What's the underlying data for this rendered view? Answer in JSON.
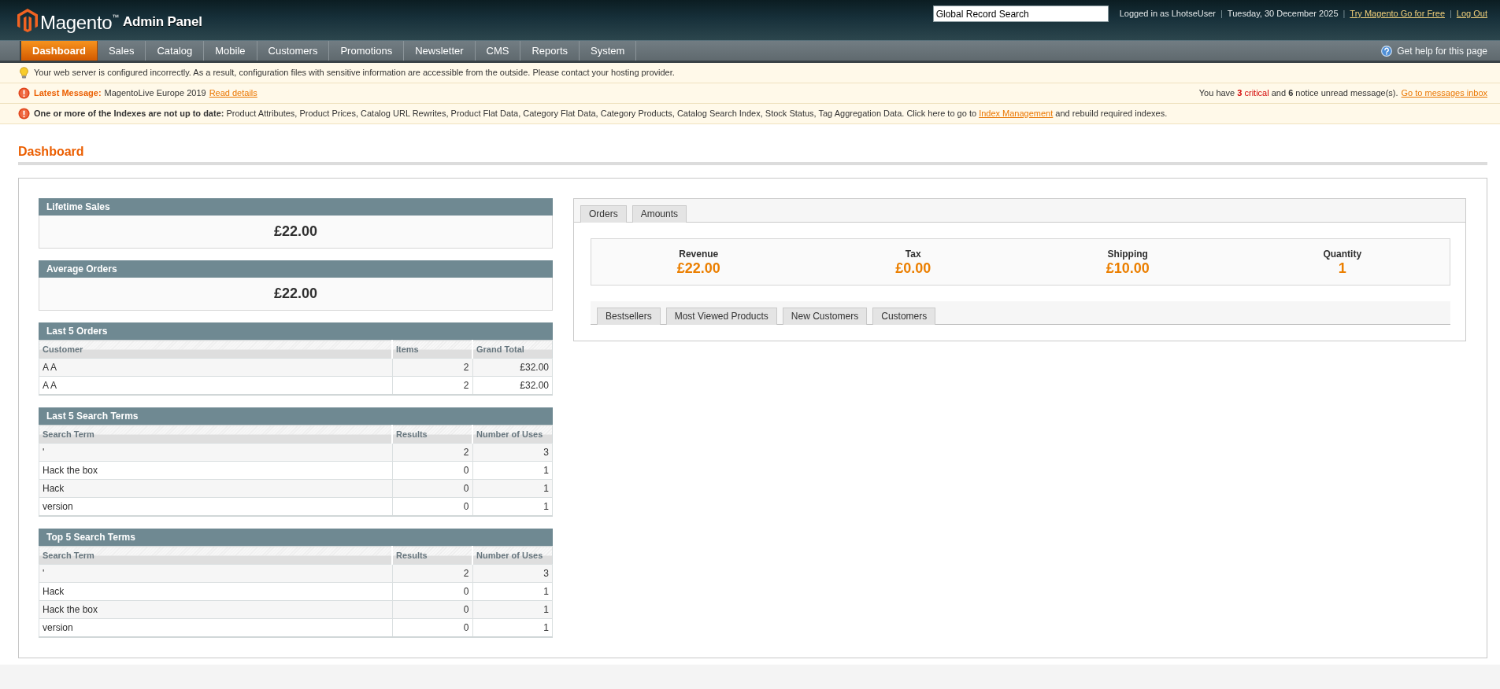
{
  "header": {
    "logo": {
      "brand": "Magento$^{™}$",
      "subtitle": "Admin Panel"
    },
    "search": {
      "value": "Global Record Search"
    },
    "user_bar": [
      {
        "kind": "text",
        "text": "Logged in as LhotseUser"
      },
      {
        "kind": "separator",
        "text": "|"
      },
      {
        "kind": "text",
        "text": "Tuesday, 30 December 2025"
      },
      {
        "kind": "separator",
        "text": "|"
      },
      {
        "kind": "link",
        "text": "Try Magento Go for Free"
      },
      {
        "kind": "separator",
        "text": "|"
      },
      {
        "kind": "link",
        "text": "Log Out"
      }
    ]
  },
  "nav": {
    "items": [
      {
        "label": "Dashboard",
        "selected": true
      },
      {
        "label": "Sales",
        "selected": false
      },
      {
        "label": "Catalog",
        "selected": false
      },
      {
        "label": "Mobile",
        "selected": false
      },
      {
        "label": "Customers",
        "selected": false
      },
      {
        "label": "Promotions",
        "selected": false
      },
      {
        "label": "Newsletter",
        "selected": false
      },
      {
        "label": "CMS",
        "selected": false
      },
      {
        "label": "Reports",
        "selected": false
      },
      {
        "label": "System",
        "selected": false
      }
    ],
    "help": "Get help for this page"
  },
  "messages": [
    {
      "kind": "notice",
      "text": "Your web server is configured incorrectly. As a result, configuration files with sensitive information are accessible from the outside. Please contact your hosting provider."
    },
    {
      "kind": "latest",
      "label": "Latest Message:",
      "text": "MagentoLive Europe 2019",
      "link": "Read details",
      "summary": {
        "lead": "You have",
        "critical_count": "3",
        "critical_label": "critical",
        "joiner": "and",
        "notice_count": "6",
        "tail": "notice unread message(s)."
      },
      "inbox_link": "Go to messages inbox"
    },
    {
      "kind": "index_warning",
      "text": "**One or more of the Indexes are not up to date:** Product Attributes, Product Prices, Catalog URL Rewrites, Product Flat Data, Category Flat Data, Category Products, Catalog Search Index, Stock Status, Tag Aggregation Data. Click here to go to",
      "link": "Index Management",
      "text_after": "and rebuild required indexes."
    }
  ],
  "page_title": "Dashboard",
  "left_panels": [
    {
      "kind": "stat",
      "title": "Lifetime Sales",
      "value": "£22.00"
    },
    {
      "kind": "stat",
      "title": "Average Orders",
      "value": "£22.00"
    },
    {
      "kind": "grid",
      "title": "Last 5 Orders",
      "columns": [
        "Customer",
        "Items",
        "Grand Total"
      ],
      "rows": [
        [
          "A A",
          "2",
          "£32.00"
        ],
        [
          "A A",
          "2",
          "£32.00"
        ]
      ]
    },
    {
      "kind": "grid",
      "title": "Last 5 Search Terms",
      "columns": [
        "Search Term",
        "Results",
        "Number of Uses"
      ],
      "rows": [
        [
          "'",
          "2",
          "3"
        ],
        [
          "Hack the box",
          "0",
          "1"
        ],
        [
          "Hack",
          "0",
          "1"
        ],
        [
          "version",
          "0",
          "1"
        ]
      ]
    },
    {
      "kind": "grid",
      "title": "Top 5 Search Terms",
      "columns": [
        "Search Term",
        "Results",
        "Number of Uses"
      ],
      "rows": [
        [
          "'",
          "2",
          "3"
        ],
        [
          "Hack",
          "0",
          "1"
        ],
        [
          "Hack the box",
          "0",
          "1"
        ],
        [
          "version",
          "0",
          "1"
        ]
      ]
    }
  ],
  "right_panel": {
    "tabs": [
      {
        "label": "Orders",
        "selected": false
      },
      {
        "label": "Amounts",
        "selected": false
      }
    ],
    "totals": [
      {
        "label": "Revenue",
        "value": "£22.00"
      },
      {
        "label": "Tax",
        "value": "£0.00"
      },
      {
        "label": "Shipping",
        "value": "£10.00"
      },
      {
        "label": "Quantity",
        "value": "1"
      }
    ],
    "grid_tabs": [
      {
        "label": "Bestsellers",
        "selected": false
      },
      {
        "label": "Most Viewed Products",
        "selected": false
      },
      {
        "label": "New Customers",
        "selected": false
      },
      {
        "label": "Customers",
        "selected": false
      }
    ]
  }
}
